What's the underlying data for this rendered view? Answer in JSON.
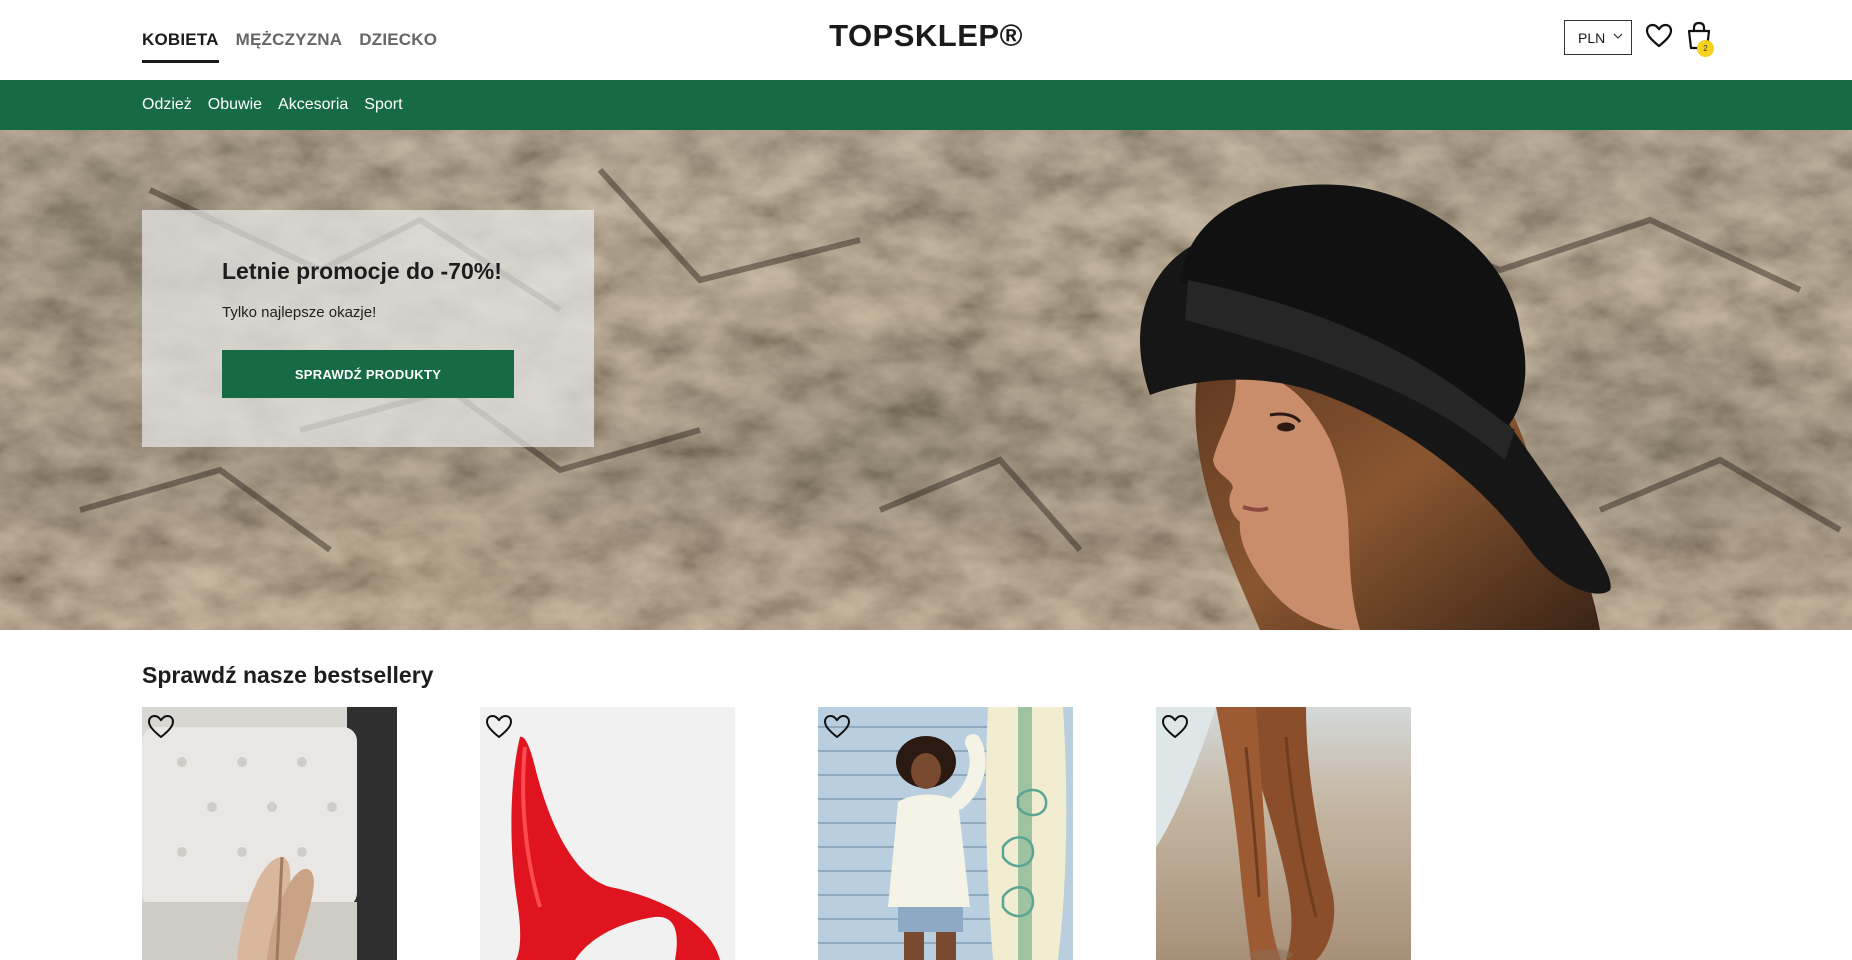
{
  "header": {
    "gender_tabs": [
      {
        "label": "KOBIETA",
        "active": true
      },
      {
        "label": "MĘŻCZYZNA",
        "active": false
      },
      {
        "label": "DZIECKO",
        "active": false
      }
    ],
    "logo": "TOPSKLEP®",
    "currency": "PLN",
    "cart_count": "2",
    "icons": [
      "chevron-down-icon",
      "heart-icon",
      "shopping-bag-icon"
    ]
  },
  "category_nav": {
    "items": [
      "Odzież",
      "Obuwie",
      "Akcesoria",
      "Sport"
    ]
  },
  "hero": {
    "title": "Letnie promocje do -70%!",
    "subtitle": "Tylko najlepsze okazje!",
    "cta": "SPRAWDŹ PRODUKTY"
  },
  "bestsellers": {
    "title": "Sprawdź nasze bestsellery",
    "products": [
      {
        "image": "beige high heels on white tufted chair"
      },
      {
        "image": "red stiletto pump"
      },
      {
        "image": "woman in white sweater by surfboard"
      },
      {
        "image": "brown trousers on sandy beach"
      }
    ]
  },
  "colors": {
    "brand_green": "#166b45",
    "badge_yellow": "#f7d21c",
    "text_dark": "#1a1a1a"
  }
}
